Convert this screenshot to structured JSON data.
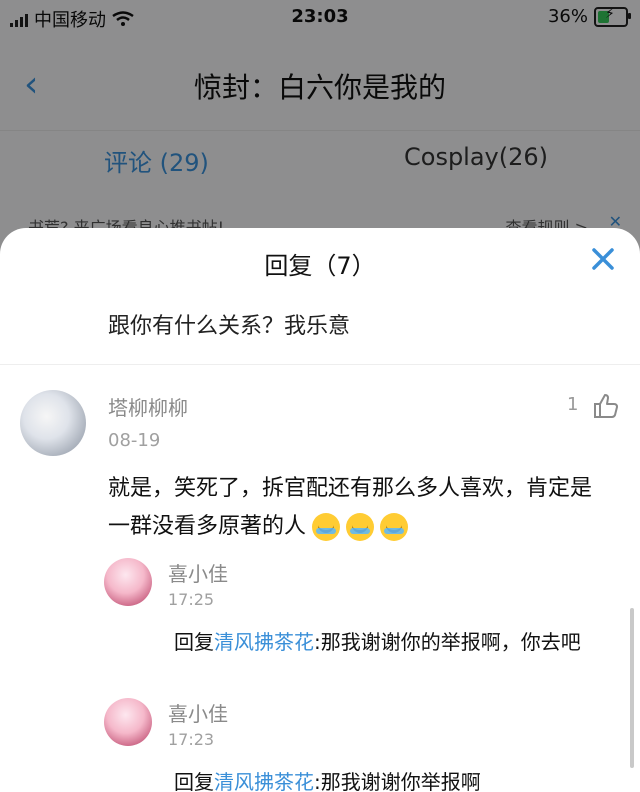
{
  "statusbar": {
    "carrier": "中国移动",
    "time": "23:03",
    "battery_percent": "36%"
  },
  "nav": {
    "back_icon": "chevron-left-icon",
    "title": "惊封：白六你是我的"
  },
  "tabs": [
    {
      "label": "评论 (29)",
      "active": true
    },
    {
      "label": "Cosplay(26)",
      "active": false
    }
  ],
  "notice": {
    "left": "书荒? 来广场看良心推书帖!",
    "right": "查看规则 >"
  },
  "sheet": {
    "title": "回复（7）",
    "parent_text": "跟你有什么关系？我乐意",
    "main_comment": {
      "user": "塔柳柳柳",
      "date": "08-19",
      "likes": "1",
      "text": "就是，笑死了，拆官配还有那么多人喜欢，肯定是一群没看多原著的人"
    },
    "replies": [
      {
        "user": "喜小佳",
        "time": "17:25",
        "prefix": "回复",
        "mention": "清风拂茶花",
        "text": ":那我谢谢你的举报啊，你去吧"
      },
      {
        "user": "喜小佳",
        "time": "17:23",
        "prefix": "回复",
        "mention": "清风拂茶花",
        "text": ":那我谢谢你举报啊"
      }
    ]
  },
  "colors": {
    "accent": "#3a8fd8"
  }
}
